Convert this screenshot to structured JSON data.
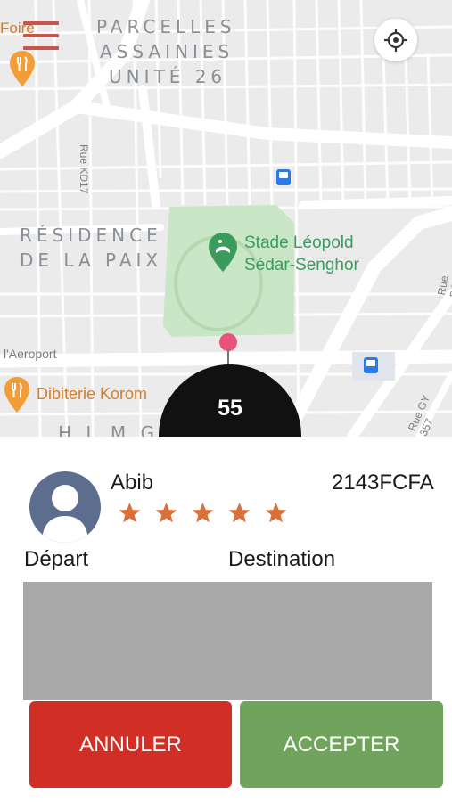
{
  "map": {
    "neighborhood_top_line1": "PARCELLES",
    "neighborhood_top_line2": "ASSAINIES",
    "neighborhood_top_line3": "UNITÉ 26",
    "neighborhood_mid_line1": "RÉSIDENCE",
    "neighborhood_mid_line2": "DE LA PAIX",
    "neighborhood_bottom": "H L M  G",
    "street_kd17": "Rue KD17",
    "street_aeroport": "l'Aeroport",
    "street_gy357": "Rue GY 357",
    "street_po": "Rue PO",
    "poi_foire": "Foire",
    "poi_dibiterie": "Dibiterie Korom",
    "park_line1": "Stade Léopold",
    "park_line2": "Sédar-Senghor",
    "eta": "55",
    "colors": {
      "background": "#ebebeb",
      "road": "#ffffff",
      "park": "#c9e7c6",
      "poi": "#f29d37",
      "transit": "#2c7be5",
      "pin": "#e9527a"
    }
  },
  "driver": {
    "name": "Abib",
    "rating": 5,
    "price": "2143FCFA"
  },
  "trip": {
    "depart_label": "Départ",
    "destination_label": "Destination"
  },
  "actions": {
    "cancel_label": "ANNULER",
    "accept_label": "ACCEPTER",
    "cancel_color": "#d12f26",
    "accept_color": "#70a35b"
  }
}
